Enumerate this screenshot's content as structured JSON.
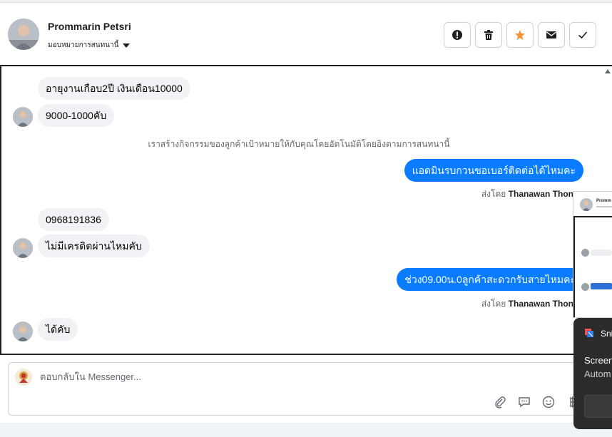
{
  "header": {
    "name": "Prommarin Petsri",
    "assign_label": "มอบหมายการสนทนานี้",
    "actions": [
      {
        "name": "spam-button",
        "icon": "exclamation-icon"
      },
      {
        "name": "delete-button",
        "icon": "trash-icon"
      },
      {
        "name": "follow-up-button",
        "icon": "star-icon",
        "color": "#f7923a"
      },
      {
        "name": "mark-unread-button",
        "icon": "envelope-icon"
      },
      {
        "name": "mark-done-button",
        "icon": "checkmark-icon"
      }
    ]
  },
  "thread": {
    "messages": [
      {
        "direction": "in",
        "text": "อายุงานเกือบ2ปี เงินเดือน10000"
      },
      {
        "direction": "in",
        "text": "9000-1000คับ"
      },
      {
        "direction": "system",
        "text": "เราสร้างกิจกรรมของลูกค้าเป้าหมายให้กับคุณโดยอัตโนมัติโดยอิงตามการสนทนานี้"
      },
      {
        "direction": "out",
        "text": "แอดมินรบกวนขอเบอร์ติดต่อได้ไหมคะ",
        "sent_by_prefix": "ส่งโดย",
        "sent_by_name": "Thanawan Thon"
      },
      {
        "direction": "in",
        "text": "0968191836"
      },
      {
        "direction": "in",
        "text": "ไม่มีเครดิตผ่านไหมคับ"
      },
      {
        "direction": "out",
        "text": "ช่วง09.00น.0ลูกค้าสะดวกรับสายไหมคะ",
        "sent_by_prefix": "ส่งโดย",
        "sent_by_name": "Thanawan Thon"
      },
      {
        "direction": "in",
        "text": "ได้คับ"
      }
    ]
  },
  "composer": {
    "placeholder": "ตอบกลับใน Messenger...",
    "tools": [
      "paperclip-icon",
      "saved-reply-icon",
      "emoji-icon",
      "baht-icon"
    ]
  },
  "overlays": {
    "mini_thumb": {
      "name": "Promm"
    },
    "snip": {
      "title": "Sni",
      "line1": "Screen",
      "line2": "Autom"
    }
  },
  "colors": {
    "outgoing_bubble": "#0a7cff",
    "incoming_bubble": "#f0f2f5",
    "accent_star": "#f7923a"
  }
}
